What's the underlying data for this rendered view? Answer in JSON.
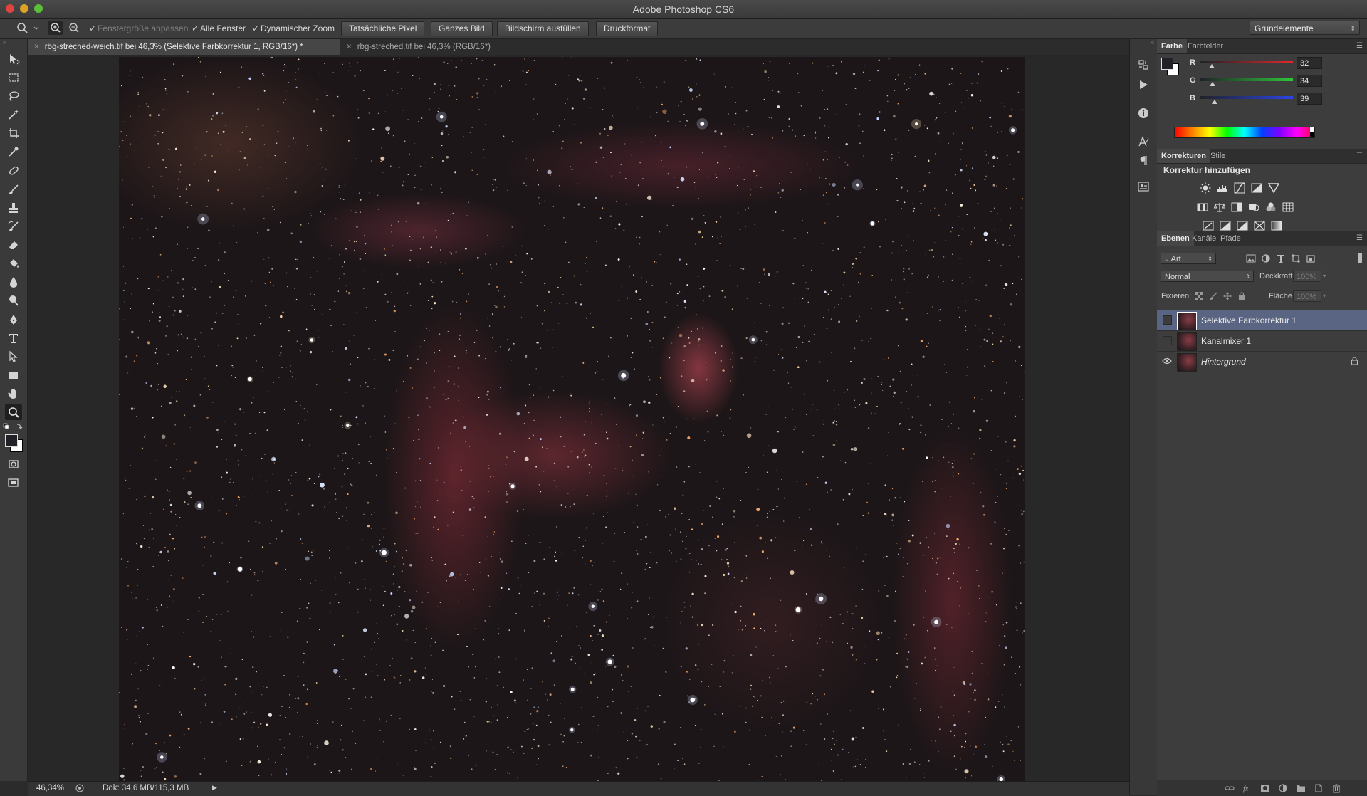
{
  "window": {
    "title": "Adobe Photoshop CS6"
  },
  "options": {
    "fit_window": "Fenstergröße anpassen",
    "all_windows": "Alle Fenster",
    "dynamic_zoom": "Dynamischer Zoom",
    "actual_pixels": "Tatsächliche Pixel",
    "fit_screen": "Ganzes Bild",
    "fill_screen": "Bildschirm ausfüllen",
    "print_size": "Druckformat",
    "workspace": "Grundelemente"
  },
  "tabs": [
    {
      "label": "rbg-streched-weich.tif bei 46,3% (Selektive Farbkorrektur 1, RGB/16*) *",
      "close": "×"
    },
    {
      "label": "rbg-streched.tif bei 46,3% (RGB/16*)",
      "close": "×"
    }
  ],
  "status": {
    "zoom": "46,34%",
    "doc": "Dok: 34,6 MB/115,3 MB"
  },
  "color_panel": {
    "tabs": [
      "Farbe",
      "Farbfelder"
    ],
    "channels": [
      {
        "label": "R",
        "value": "32",
        "fraction": 0.125
      },
      {
        "label": "G",
        "value": "34",
        "fraction": 0.133
      },
      {
        "label": "B",
        "value": "39",
        "fraction": 0.153
      }
    ],
    "colors": {
      "red": "#e0282c",
      "green": "#2ec63a",
      "blue": "#2b44e6"
    }
  },
  "adjustments_panel": {
    "tabs": [
      "Korrekturen",
      "Stile"
    ],
    "title": "Korrektur hinzufügen"
  },
  "layers_panel": {
    "tabs": [
      "Ebenen",
      "Kanäle",
      "Pfade"
    ],
    "filter": "Art",
    "blend_mode": "Normal",
    "opacity_label": "Deckkraft:",
    "opacity_value": "100%",
    "lock_label": "Fixieren:",
    "fill_label": "Fläche:",
    "fill_value": "100%",
    "layers": [
      {
        "name": "Selektive Farbkorrektur 1",
        "selected": true,
        "visible": false
      },
      {
        "name": "Kanalmixer 1",
        "selected": false,
        "visible": false
      },
      {
        "name": "Hintergrund",
        "selected": false,
        "visible": true,
        "locked": true
      }
    ]
  }
}
